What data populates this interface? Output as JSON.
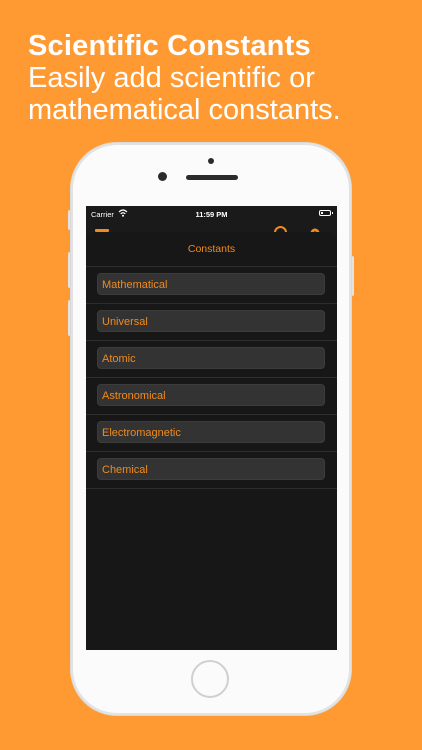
{
  "headline": {
    "title": "Scientific Constants",
    "subtitle_line1": "Easily add scientific or",
    "subtitle_line2": "mathematical constants."
  },
  "status_bar": {
    "carrier": "Carrier",
    "time": "11:59 PM"
  },
  "sheet": {
    "title": "Constants",
    "items": [
      {
        "label": "Mathematical"
      },
      {
        "label": "Universal"
      },
      {
        "label": "Atomic"
      },
      {
        "label": "Astronomical"
      },
      {
        "label": "Electromagnetic"
      },
      {
        "label": "Chemical"
      }
    ]
  },
  "icons": {
    "wifi": "wifi-icon",
    "battery": "battery-icon",
    "menu": "menu-icon",
    "clock": "clock-icon",
    "gear": "gear-icon"
  },
  "colors": {
    "background": "#FF9A33",
    "accent": "#F28A1E",
    "screen": "#171717",
    "button": "#333333"
  }
}
